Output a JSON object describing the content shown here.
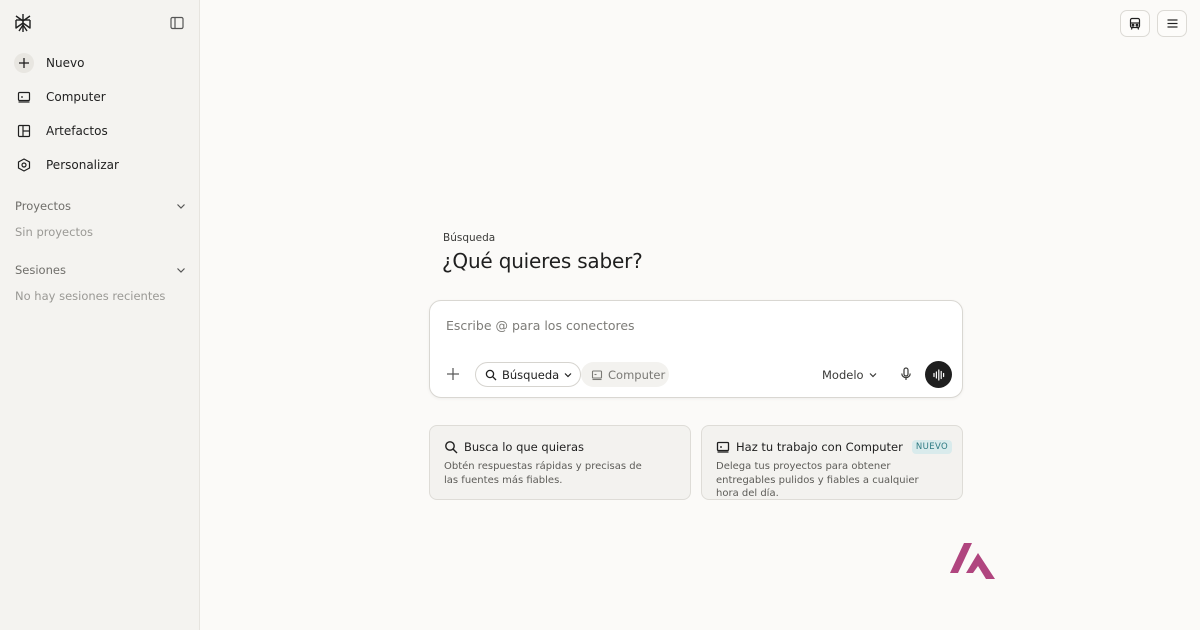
{
  "sidebar": {
    "nav": [
      {
        "label": "Nuevo",
        "icon": "plus-icon"
      },
      {
        "label": "Computer",
        "icon": "monitor-icon"
      },
      {
        "label": "Artefactos",
        "icon": "layout-icon"
      },
      {
        "label": "Personalizar",
        "icon": "hexagon-settings-icon"
      }
    ],
    "sections": [
      {
        "label": "Proyectos",
        "empty_text": "Sin proyectos"
      },
      {
        "label": "Sesiones",
        "empty_text": "No hay sesiones recientes"
      }
    ]
  },
  "main": {
    "mode_label": "Búsqueda",
    "headline": "¿Qué quieres saber?",
    "composer": {
      "placeholder": "Escribe @ para los conectores",
      "mode_pill": "Búsqueda",
      "computer_pill": "Computer",
      "model_label": "Modelo"
    },
    "cards": [
      {
        "title": "Busca lo que quieras",
        "icon": "search-icon",
        "description": "Obtén respuestas rápidas y precisas de las fuentes más fiables."
      },
      {
        "title": "Haz tu trabajo con Computer",
        "icon": "monitor-icon",
        "badge": "NUEVO",
        "description": "Delega tus proyectos para obtener entregables pulidos y fiables a cualquier hora del día."
      }
    ]
  },
  "colors": {
    "background": "#fbfaf8",
    "sidebar": "#f4f3f0",
    "badge_text": "#2f7b83",
    "badge_bg": "#d9ebec",
    "brand_mark": "#b0457f"
  }
}
